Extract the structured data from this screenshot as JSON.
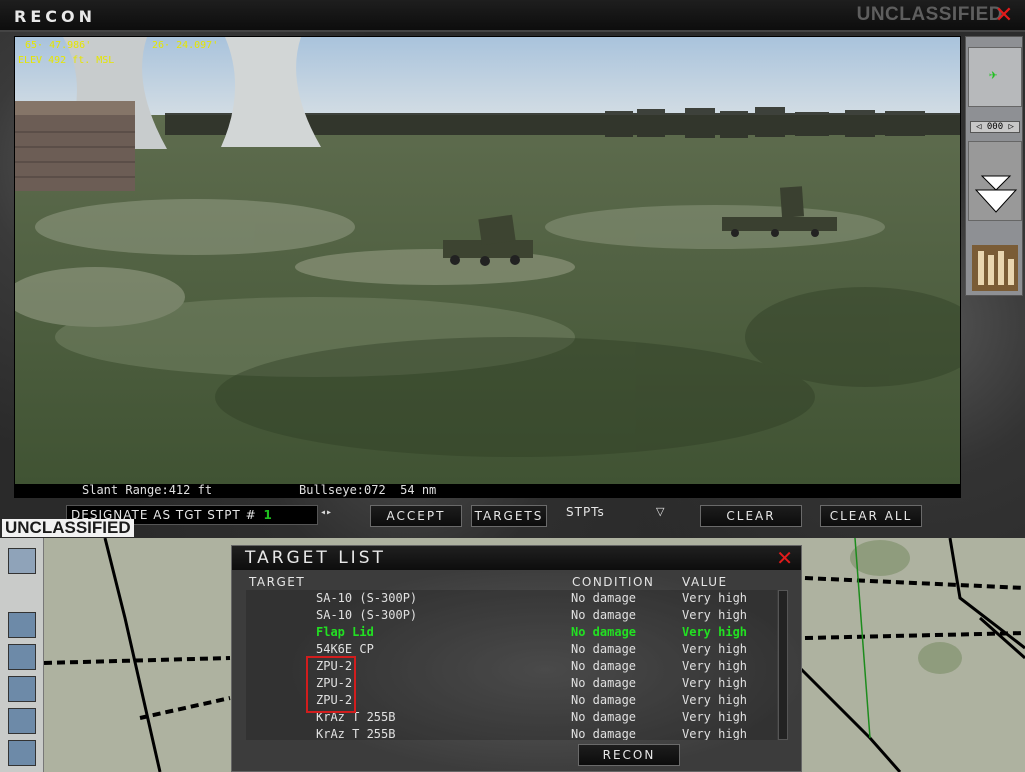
{
  "recon_window": {
    "title": "RECON",
    "classification_top": "UNCLASSIFIED",
    "close_icon": "x-icon",
    "hud": {
      "latitude": "65· 47.986'",
      "longitude": "26· 24.097'",
      "elevation": "ELEV 492 ft. MSL"
    },
    "slant_range": "Slant Range:412 ft",
    "bullseye": "Bullseye:072  54 nm",
    "heading_readout": "◁ 000 ▷",
    "controls": {
      "designate_label": "DESIGNATE AS TGT STPT #",
      "designate_value": "1",
      "spinner": "◂▸",
      "accept": "ACCEPT",
      "targets": "TARGETS",
      "stpts": "STPTs",
      "clear": "CLEAR",
      "clear_all": "CLEAR ALL"
    },
    "classification_bottom": "UNCLASSIFIED"
  },
  "target_list": {
    "title": "TARGET LIST",
    "headers": {
      "target": "TARGET",
      "condition": "CONDITION",
      "value": "VALUE"
    },
    "rows": [
      {
        "target": "SA-10 (S-300P)",
        "condition": "No damage",
        "value": "Very high",
        "selected": false
      },
      {
        "target": "SA-10 (S-300P)",
        "condition": "No damage",
        "value": "Very high",
        "selected": false
      },
      {
        "target": "Flap Lid",
        "condition": "No damage",
        "value": "Very high",
        "selected": true
      },
      {
        "target": "54K6E CP",
        "condition": "No damage",
        "value": "Very high",
        "selected": false
      },
      {
        "target": "ZPU-2",
        "condition": "No damage",
        "value": "Very high",
        "selected": false
      },
      {
        "target": "ZPU-2",
        "condition": "No damage",
        "value": "Very high",
        "selected": false
      },
      {
        "target": "ZPU-2",
        "condition": "No damage",
        "value": "Very high",
        "selected": false
      },
      {
        "target": "KrAz T 255B",
        "condition": "No damage",
        "value": "Very high",
        "selected": false
      },
      {
        "target": "KrAz T 255B",
        "condition": "No damage",
        "value": "Very high",
        "selected": false
      }
    ],
    "recon_button": "RECON"
  },
  "colors": {
    "selected_row": "#22e022",
    "close": "#e21b1b",
    "hud_text": "#e6e600",
    "designate_value": "#1ec01e"
  }
}
